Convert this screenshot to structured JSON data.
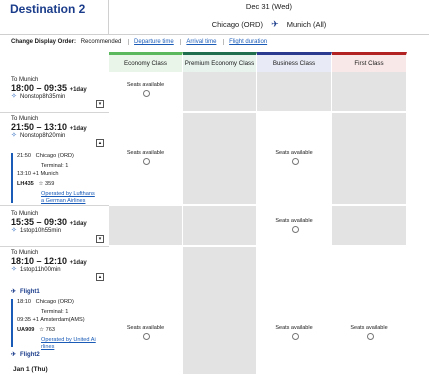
{
  "header": {
    "title": "Destination 2",
    "date": "Dec 31 (Wed)",
    "origin": "Chicago (ORD)",
    "destination": "Munich (All)"
  },
  "display_order": {
    "label": "Change Display Order:",
    "current": "Recommended",
    "options": [
      "Departure time",
      "Arrival time",
      "Flight duration"
    ]
  },
  "cabins": [
    {
      "name": "Economy Class",
      "color": "#5cb85c"
    },
    {
      "name": "Premium Economy Class",
      "color": "#1f6f4e"
    },
    {
      "name": "Business Class",
      "color": "#2a3b8f"
    },
    {
      "name": "First Class",
      "color": "#b22222"
    }
  ],
  "seat_text": "Seats available",
  "flights": [
    {
      "to": "To Munich",
      "dep": "18:00",
      "arr": "09:35",
      "day": "+1day",
      "stops": "Nonstop8h35min"
    },
    {
      "to": "To Munich",
      "dep": "21:50",
      "arr": "13:10",
      "day": "+1day",
      "stops": "Nonstop8h20min",
      "detail": {
        "dep_time": "21:50",
        "dep_airport": "Chicago (ORD)",
        "terminal": "Terminal: 1",
        "arr_time": "13:10 +1",
        "arr_city": "Munich",
        "flight_no": "LH435",
        "aircraft": "359",
        "operated_1": "Operated by Lufthans",
        "operated_2": "a German Airlines"
      }
    },
    {
      "to": "To Munich",
      "dep": "15:35",
      "arr": "09:30",
      "day": "+1day",
      "stops": "1stop10h55min"
    },
    {
      "to": "To Munich",
      "dep": "18:10",
      "arr": "12:10",
      "day": "+1day",
      "stops": "1stop11h00min",
      "flight1": "Flight1",
      "detail": {
        "dep_time": "18:10",
        "dep_airport": "Chicago (ORD)",
        "terminal": "Terminal: 1",
        "arr_time": "09:35 +1",
        "arr_city": "Amsterdam(AMS)",
        "flight_no": "UA909",
        "aircraft": "763",
        "operated_1": "Operated by United Ai",
        "operated_2": "rlines"
      },
      "flight2": "Flight2",
      "next_date": "Jan 1 (Thu)"
    }
  ]
}
